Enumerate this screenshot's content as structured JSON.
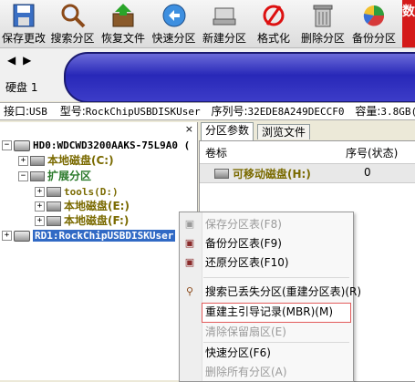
{
  "toolbar": {
    "buttons": [
      {
        "label": "保存更改",
        "icon": "save-icon"
      },
      {
        "label": "搜索分区",
        "icon": "magnifier-icon"
      },
      {
        "label": "恢复文件",
        "icon": "recover-box-icon"
      },
      {
        "label": "快速分区",
        "icon": "quick-partition-icon"
      },
      {
        "label": "新建分区",
        "icon": "new-partition-icon"
      },
      {
        "label": "格式化",
        "icon": "format-icon"
      },
      {
        "label": "删除分区",
        "icon": "trash-icon"
      },
      {
        "label": "备份分区",
        "icon": "pie-icon"
      }
    ],
    "cut_label": "数"
  },
  "diskbar": {
    "label": "硬盘 1"
  },
  "info": {
    "iface_label": "接口:",
    "iface_value": "USB",
    "model_label": "型号:",
    "model_value": "RockChipUSBDISKUser",
    "serial_label": "序列号:",
    "serial_value": "32EDE8A249DECCF0",
    "capacity_label": "容量:",
    "capacity_value": "3.8GB(386"
  },
  "tree": {
    "close": "×",
    "hd0": "HD0:WDCWD3200AAKS-75L9A0 (",
    "c": "本地磁盘(C:)",
    "ext": "扩展分区",
    "tools": "tools(D:)",
    "e": "本地磁盘(E:)",
    "f": "本地磁盘(F:)",
    "rd1": "RD1:RockChipUSBDISKUser"
  },
  "tabs": {
    "partition_params": "分区参数",
    "browse_files": "浏览文件"
  },
  "grid": {
    "col_label": "卷标",
    "col_index": "序号(状态)",
    "row_label": "可移动磁盘(H:)",
    "row_index": "0"
  },
  "menu": {
    "items": [
      {
        "label": "保存分区表(F8)",
        "disabled": true
      },
      {
        "label": "备份分区表(F9)",
        "disabled": false
      },
      {
        "label": "还原分区表(F10)",
        "disabled": false
      },
      {
        "label": "搜索已丢失分区(重建分区表)(R)",
        "disabled": false
      },
      {
        "label": "重建主引导记录(MBR)(M)",
        "disabled": false
      },
      {
        "label": "清除保留扇区(E)",
        "disabled": true
      },
      {
        "label": "快速分区(F6)",
        "disabled": false
      },
      {
        "label": "删除所有分区(A)",
        "disabled": true
      }
    ]
  }
}
